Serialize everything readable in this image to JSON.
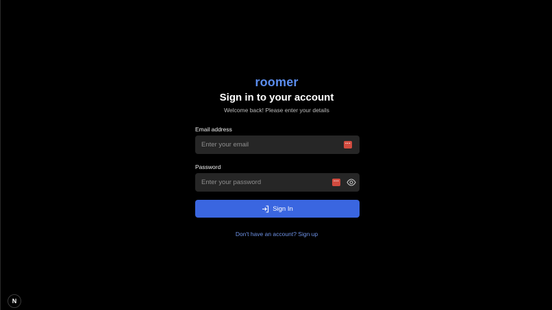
{
  "brand": {
    "name": "roomer",
    "color": "#5b8dee"
  },
  "header": {
    "title": "Sign in to your account",
    "subtitle": "Welcome back! Please enter your details"
  },
  "form": {
    "email": {
      "label": "Email address",
      "value": "",
      "placeholder": "Enter your email",
      "autofill_icon": "password-manager-icon"
    },
    "password": {
      "label": "Password",
      "value": "",
      "placeholder": "Enter your password",
      "autofill_icon": "password-manager-icon",
      "toggle_icon": "eye-icon"
    },
    "submit": {
      "label": "Sign In",
      "icon": "login-icon",
      "color": "#3a66e0"
    }
  },
  "footer": {
    "signup_link": "Don't have an account? Sign up"
  },
  "dev_badge": {
    "letter": "N",
    "icon": "nextjs-logo-icon"
  }
}
